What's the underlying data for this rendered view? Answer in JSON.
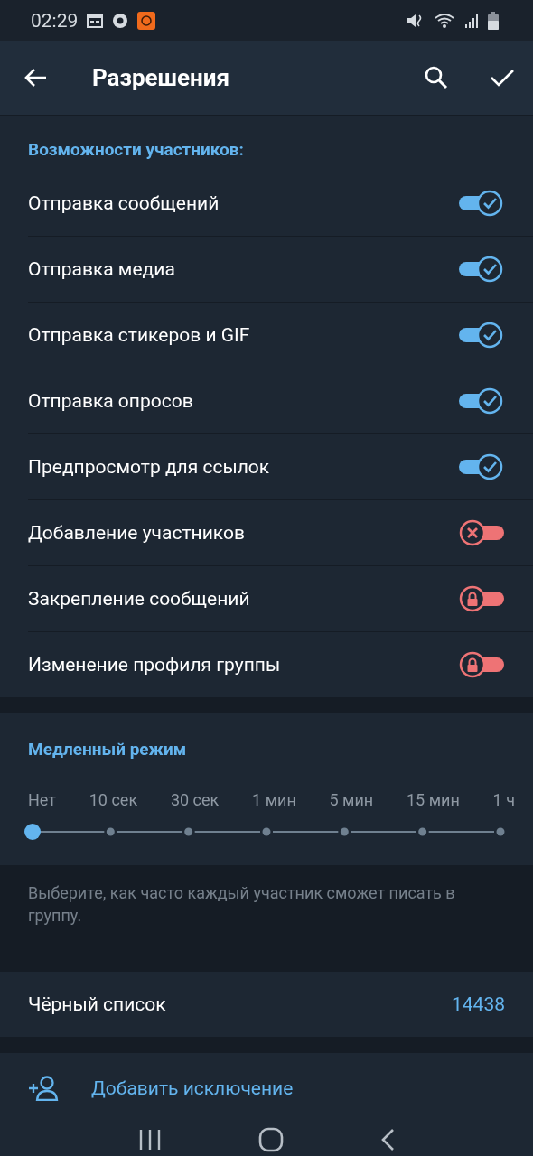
{
  "status_bar": {
    "time": "02:29"
  },
  "header": {
    "title": "Разрешения"
  },
  "permissions": {
    "title": "Возможности участников:",
    "items": [
      {
        "label": "Отправка сообщений",
        "on": true
      },
      {
        "label": "Отправка медиа",
        "on": true
      },
      {
        "label": "Отправка стикеров и GIF",
        "on": true
      },
      {
        "label": "Отправка опросов",
        "on": true
      },
      {
        "label": "Предпросмотр для ссылок",
        "on": true
      },
      {
        "label": "Добавление участников",
        "on": false,
        "locked": false
      },
      {
        "label": "Закрепление сообщений",
        "on": false,
        "locked": true
      },
      {
        "label": "Изменение профиля группы",
        "on": false,
        "locked": true
      }
    ]
  },
  "slow_mode": {
    "title": "Медленный режим",
    "steps": [
      {
        "label": "Нет",
        "selected": true
      },
      {
        "label": "10 сек",
        "selected": false
      },
      {
        "label": "30 сек",
        "selected": false
      },
      {
        "label": "1 мин",
        "selected": false
      },
      {
        "label": "5 мин",
        "selected": false
      },
      {
        "label": "15 мин",
        "selected": false
      },
      {
        "label": "1 ч",
        "selected": false
      }
    ],
    "hint": "Выберите, как часто каждый участник сможет писать в группу."
  },
  "blacklist": {
    "label": "Чёрный список",
    "count": "14438"
  },
  "add_exception": {
    "label": "Добавить исключение"
  }
}
